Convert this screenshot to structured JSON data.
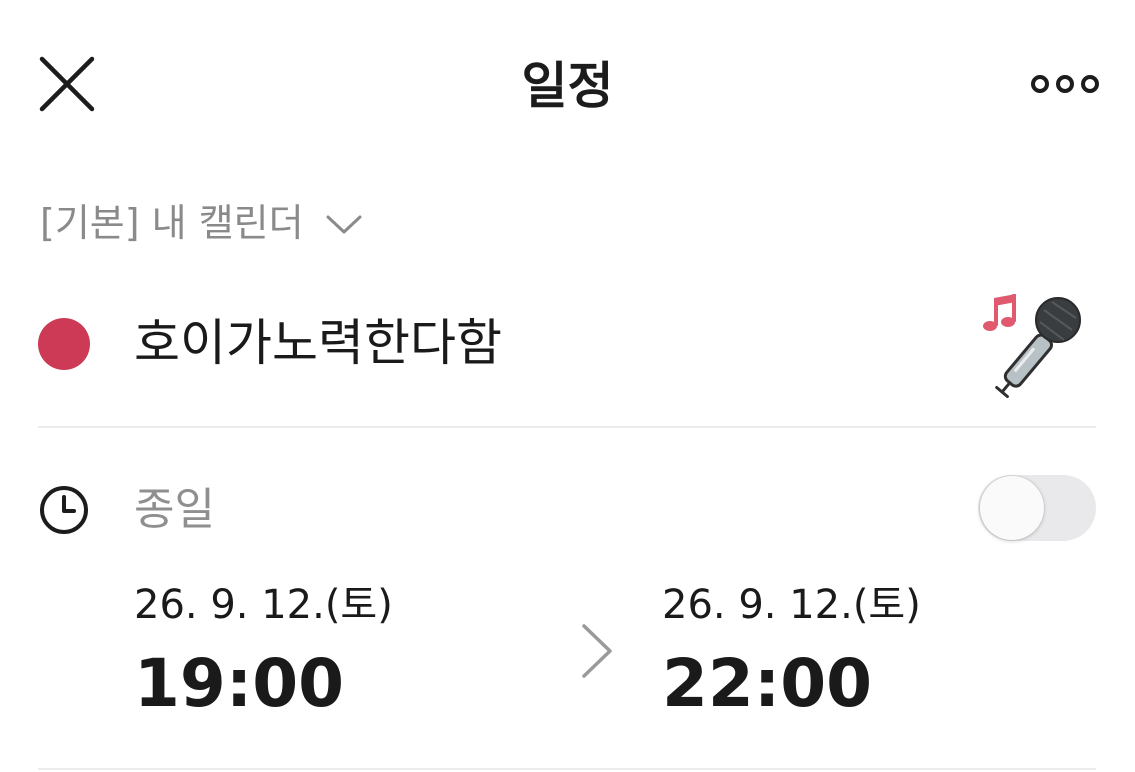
{
  "header": {
    "title": "일정",
    "close_icon": "close-icon",
    "more_icon": "more-horizontal-icon"
  },
  "calendar": {
    "label": "[기본] 내 캘린더",
    "chevron_icon": "chevron-down-icon"
  },
  "event": {
    "color": "#cc3a55",
    "title": "호이가노력한다함",
    "sticker_icon": "microphone-music-icon"
  },
  "all_day": {
    "label": "종일",
    "enabled": false,
    "clock_icon": "clock-icon"
  },
  "schedule": {
    "start": {
      "date": "26. 9. 12.(토)",
      "time": "19:00"
    },
    "end": {
      "date": "26. 9. 12.(토)",
      "time": "22:00"
    },
    "arrow_icon": "chevron-right-icon"
  },
  "colors": {
    "divider": "#ececec",
    "muted_text": "#8a8a8a",
    "toggle_off": "#e9e9eb"
  }
}
